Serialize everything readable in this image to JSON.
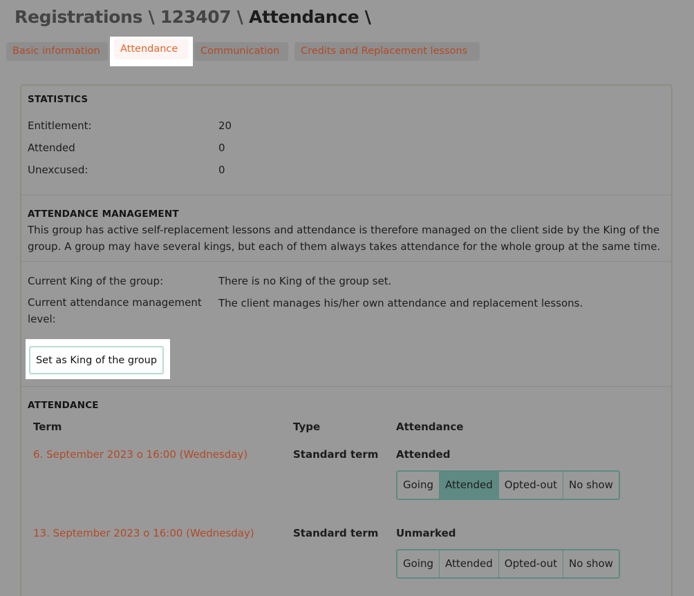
{
  "header": {
    "breadcrumb_root": "Registrations \\",
    "breadcrumb_id": "123407 \\",
    "breadcrumb_current": "Attendance \\"
  },
  "tabs": [
    {
      "label": "Basic information",
      "active": false
    },
    {
      "label": "Attendance",
      "active": true
    },
    {
      "label": "Communication",
      "active": false
    },
    {
      "label": "Credits and Replacement lessons",
      "active": false
    }
  ],
  "statistics": {
    "title": "STATISTICS",
    "rows": [
      {
        "label": "Entitlement:",
        "value": "20"
      },
      {
        "label": "Attended",
        "value": "0"
      },
      {
        "label": "Unexcused:",
        "value": "0"
      }
    ]
  },
  "management": {
    "title": "ATTENDANCE MANAGEMENT",
    "description": "This group has active self-replacement lessons and attendance is therefore managed on the client side by the King of the group. A group may have several kings, but each of them always takes attendance for the whole group at the same time.",
    "king_label": "Current King of the group:",
    "king_value": "There is no King of the group set.",
    "level_label": "Current attendance management level:",
    "level_value": "The client manages his/her own attendance and replacement lessons.",
    "set_king_button": "Set as King of the group"
  },
  "attendance": {
    "title": "ATTENDANCE",
    "columns": {
      "term": "Term",
      "type": "Type",
      "attendance": "Attendance"
    },
    "options": [
      "Going",
      "Attended",
      "Opted-out",
      "No show"
    ],
    "rows": [
      {
        "term": "6. September 2023 o 16:00 (Wednesday)",
        "type": "Standard term",
        "status": "Attended",
        "selected": "Attended"
      },
      {
        "term": "13. September 2023 o 16:00 (Wednesday)",
        "type": "Standard term",
        "status": "Unmarked",
        "selected": ""
      }
    ]
  },
  "colors": {
    "background": "#999999",
    "link": "#b14a27",
    "active_tab_text": "#e0652d",
    "selected_segment": "#5f8a84"
  }
}
